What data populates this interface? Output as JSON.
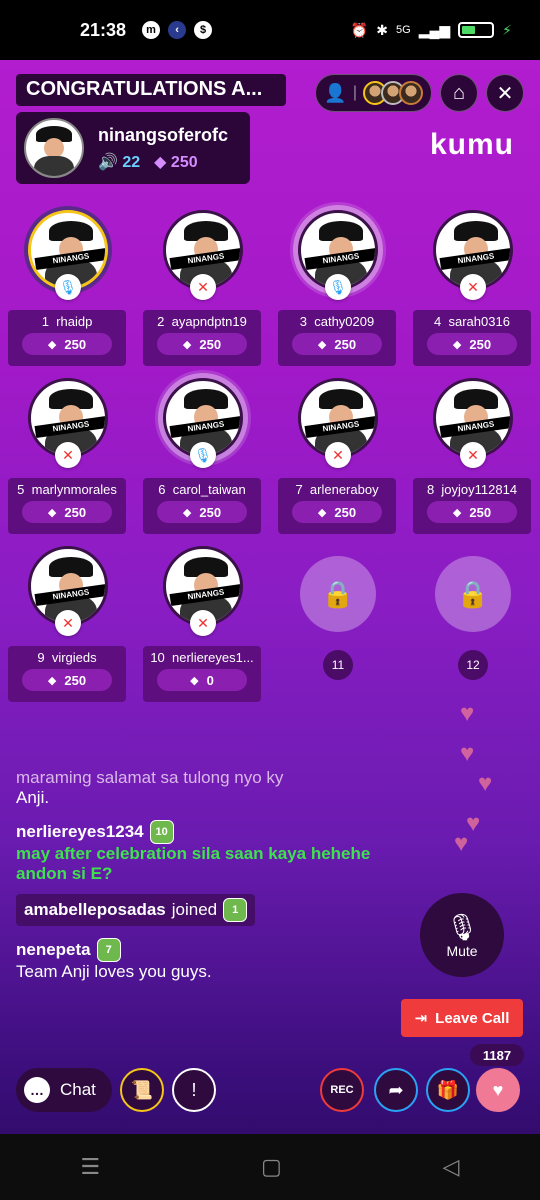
{
  "status": {
    "time": "21:38",
    "network": "5G"
  },
  "header": {
    "title": "CONGRATULATIONS A...",
    "host_name": "ninangsoferofc",
    "listeners": "22",
    "gems": "250",
    "brand": "kumu"
  },
  "slots": [
    {
      "num": "1",
      "name": "rhaidp",
      "gems": "250",
      "mic": "on"
    },
    {
      "num": "2",
      "name": "ayapndptn19",
      "gems": "250",
      "mic": "off"
    },
    {
      "num": "3",
      "name": "cathy0209",
      "gems": "250",
      "mic": "on"
    },
    {
      "num": "4",
      "name": "sarah0316",
      "gems": "250",
      "mic": "off"
    },
    {
      "num": "5",
      "name": "marlynmorales",
      "gems": "250",
      "mic": "off"
    },
    {
      "num": "6",
      "name": "carol_taiwan",
      "gems": "250",
      "mic": "on"
    },
    {
      "num": "7",
      "name": "arleneraboy",
      "gems": "250",
      "mic": "off"
    },
    {
      "num": "8",
      "name": "joyjoy112814",
      "gems": "250",
      "mic": "off"
    },
    {
      "num": "9",
      "name": "virgieds",
      "gems": "250",
      "mic": "off"
    },
    {
      "num": "10",
      "name": "nerliereyes1...",
      "gems": "0",
      "mic": "off"
    }
  ],
  "locked": [
    "11",
    "12"
  ],
  "chat": {
    "line1": "maraming salamat sa tulong nyo ky",
    "line1b": "Anji.",
    "msg2_user": "nerliereyes1234",
    "msg2_badge": "10",
    "msg2_text": "may after celebration sila saan kaya hehehe andon si E?",
    "join_user": "amabelleposadas",
    "join_text": "joined",
    "join_badge": "1",
    "msg3_user": "nenepeta",
    "msg3_badge": "7",
    "msg3_text": "Team Anji loves you guys."
  },
  "controls": {
    "mute": "Mute",
    "leave": "Leave Call",
    "count": "1187",
    "chat": "Chat",
    "rec": "REC"
  },
  "avatar_banner": "NINANGS"
}
